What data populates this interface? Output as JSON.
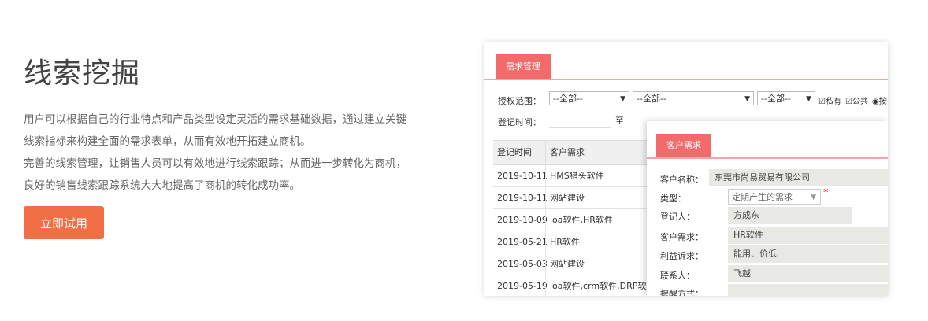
{
  "hero": {
    "title": "线索挖掘",
    "paragraphs": [
      "用户可以根据自己的行业特点和产品类型设定灵活的需求基础数据，通过建立关键",
      "线索指标来构建全面的需求表单，从而有效地开拓建立商机。",
      "完善的线索管理，让销售人员可以有效地进行线索跟踪；从而进一步转化为商机，",
      "良好的销售线索跟踪系统大大地提高了商机的转化成功率。"
    ],
    "cta_label": "立即试用"
  },
  "app": {
    "tab_label": "需求管理",
    "filter": {
      "scope_label": "授权范围：",
      "select1": "--全部--",
      "select2": "--全部--",
      "select3": "--全部--",
      "check_private": "☑私有",
      "check_public": "☑公共",
      "radio": "◉按",
      "date_label": "登记时间：",
      "date_to": "至"
    },
    "table": {
      "headers": [
        "登记时间",
        "客户需求"
      ],
      "rows": [
        [
          "2019-10-11",
          "HMS猎头软件"
        ],
        [
          "2019-10-11",
          "网站建设"
        ],
        [
          "2019-10-09",
          "ioa软件,HR软件"
        ],
        [
          "2019-05-21",
          "HR软件"
        ],
        [
          "2019-05-03",
          "网站建设"
        ],
        [
          "2019-05-19",
          "ioa软件,crm软件,DRP软件"
        ]
      ]
    },
    "popup": {
      "tab_label": "客户需求",
      "fields": {
        "name_label": "客户名称：",
        "name_value": "东莞市尚易贸易有限公司",
        "type_label": "类型：",
        "type_value": "定期产生的需求",
        "registrant_label": "登记人：",
        "registrant_value": "方成东",
        "demand_label": "客户需求：",
        "demand_value": "HR软件",
        "interest_label": "利益诉求：",
        "interest_value": "能用、价低",
        "contact_label": "联系人：",
        "contact_value": "飞越",
        "reminder_label": "提醒方式："
      },
      "required_mark": "*"
    }
  }
}
